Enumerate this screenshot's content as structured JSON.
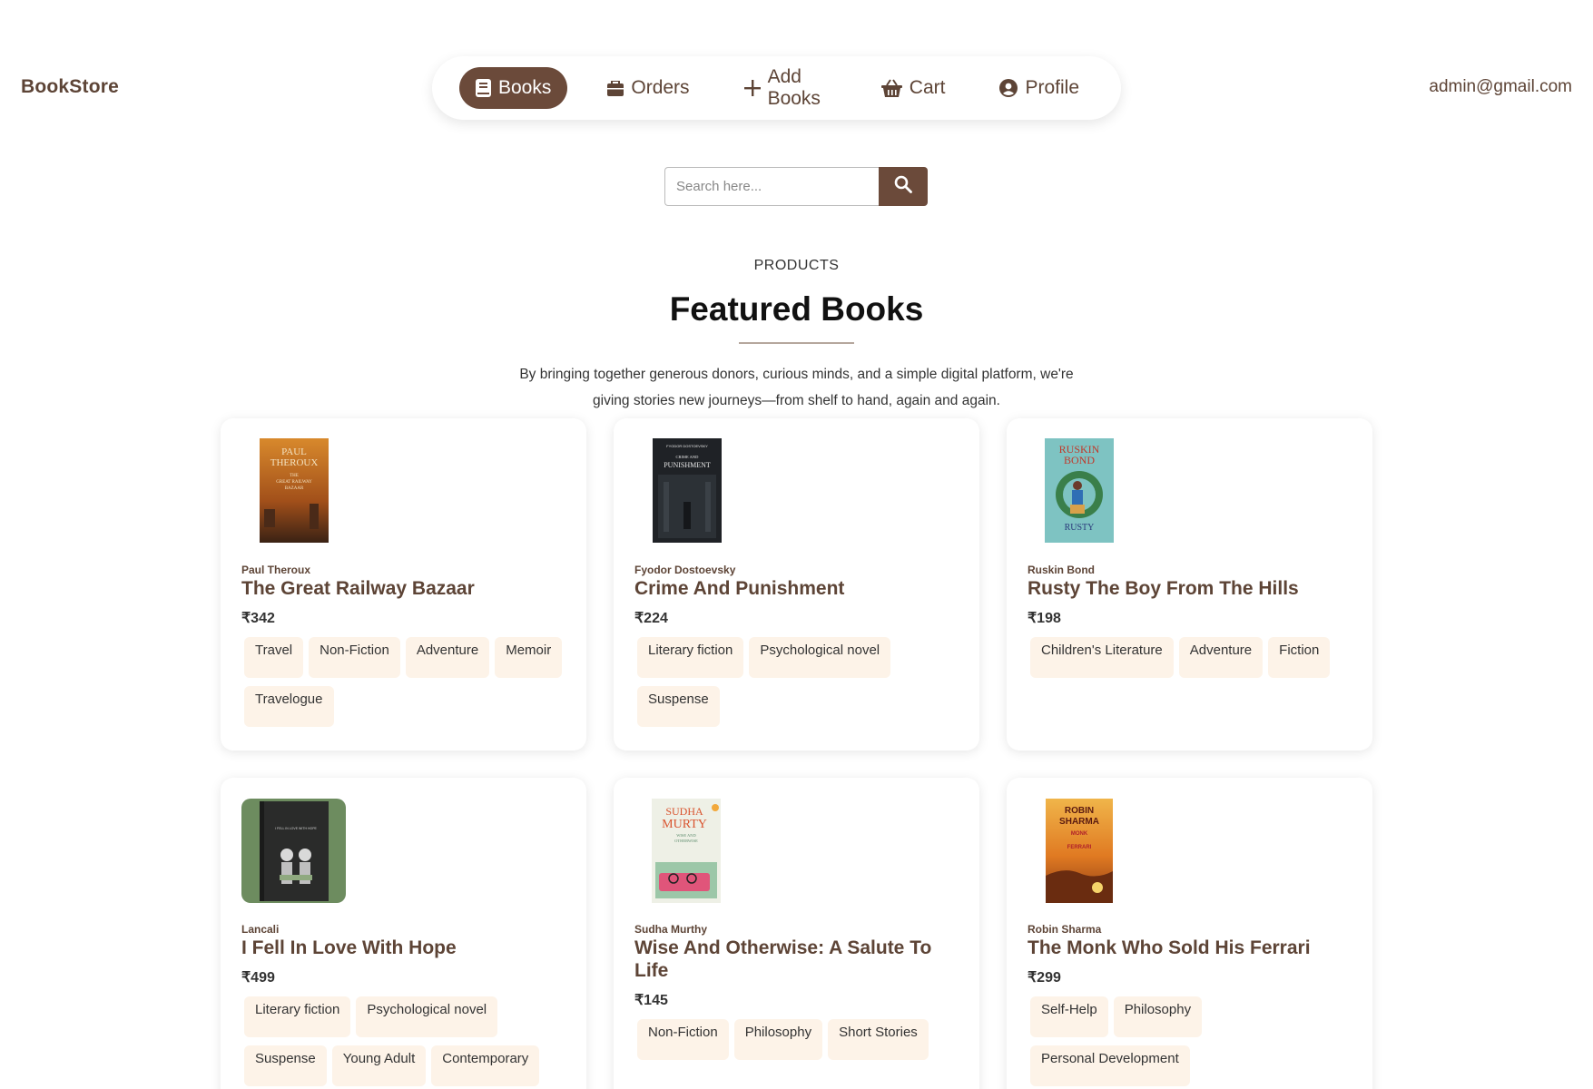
{
  "brand": "BookStore",
  "user_email": "admin@gmail.com",
  "nav": {
    "items": [
      {
        "label": "Books",
        "icon": "book-icon",
        "active": true
      },
      {
        "label": "Orders",
        "icon": "briefcase-icon",
        "active": false
      },
      {
        "label": "Add Books",
        "icon": "plus-icon",
        "active": false
      },
      {
        "label": "Cart",
        "icon": "basket-icon",
        "active": false
      },
      {
        "label": "Profile",
        "icon": "user-circle-icon",
        "active": false
      }
    ]
  },
  "search": {
    "placeholder": "Search here..."
  },
  "section": {
    "eyebrow": "PRODUCTS",
    "title": "Featured Books",
    "intro": "By bringing together generous donors, curious minds, and a simple digital platform, we're giving stories new journeys—from shelf to hand, again and again."
  },
  "books": [
    {
      "author": "Paul Theroux",
      "title": "The Great Railway Bazaar",
      "price": "₹342",
      "tags": [
        "Travel",
        "Non-Fiction",
        "Adventure",
        "Memoir",
        "Travelogue"
      ],
      "cover": {
        "text": "PAUL THEROUX",
        "sub": "THE GREAT RAILWAY BAZAAR",
        "bg": "#c96a1f",
        "fg": "#f4e3c2"
      }
    },
    {
      "author": "Fyodor Dostoevsky",
      "title": "Crime And Punishment",
      "price": "₹224",
      "tags": [
        "Literary fiction",
        "Psychological novel",
        "Suspense"
      ],
      "cover": {
        "text": "CRIME AND PUNISHMENT",
        "sub": "FYODOR DOSTOEVSKY",
        "bg": "#1f2226",
        "fg": "#e8e8e8"
      }
    },
    {
      "author": "Ruskin Bond",
      "title": "Rusty The Boy From The Hills",
      "price": "₹198",
      "tags": [
        "Children's Literature",
        "Adventure",
        "Fiction"
      ],
      "cover": {
        "text": "RUSKIN BOND",
        "sub": "RUSTY",
        "bg": "#7ec3c2",
        "fg": "#c0392b"
      }
    },
    {
      "author": "Lancali",
      "title": "I Fell In Love With Hope",
      "price": "₹499",
      "tags": [
        "Literary fiction",
        "Psychological novel",
        "Suspense",
        "Young Adult",
        "Contemporary"
      ],
      "cover": {
        "text": "I FELL IN LOVE WITH HOPE",
        "sub": "",
        "bg": "#2a2b2a",
        "fg": "#cfcfcf",
        "frame": "#6d8c5f"
      }
    },
    {
      "author": "Sudha Murthy",
      "title": "Wise And Otherwise: A Salute To Life",
      "price": "₹145",
      "tags": [
        "Non-Fiction",
        "Philosophy",
        "Short Stories"
      ],
      "cover": {
        "text": "SUDHA MURTY",
        "sub": "WISE AND OTHERWISE",
        "bg": "#eef0e6",
        "fg": "#d9532e"
      }
    },
    {
      "author": "Robin Sharma",
      "title": "The Monk Who Sold His Ferrari",
      "price": "₹299",
      "tags": [
        "Self-Help",
        "Philosophy",
        "Personal Development"
      ],
      "cover": {
        "text": "ROBIN SHARMA",
        "sub": "THE MONK WHO SOLD HIS FERRARI",
        "bg": "#e59a2a",
        "fg": "#5a1a10"
      }
    }
  ],
  "colors": {
    "accent": "#6b4a3a",
    "tag_bg": "#fdf3e8",
    "text_brown": "#5d4436"
  }
}
